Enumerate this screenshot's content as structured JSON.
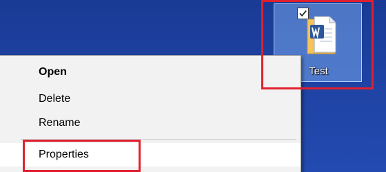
{
  "desktop": {
    "icon": {
      "label": "Test",
      "icon_name": "word-document-icon",
      "checkbox_checked": true,
      "checkmark_glyph": "✓"
    }
  },
  "context_menu": {
    "items": [
      {
        "label": "Open"
      },
      {
        "label": "Delete"
      },
      {
        "label": "Rename"
      },
      {
        "label": "Properties"
      }
    ]
  },
  "colors": {
    "desktop_bg": "#1f44a6",
    "highlight": "#e0202e",
    "menu_bg": "#f2f2f2",
    "word_blue": "#2b579a"
  }
}
